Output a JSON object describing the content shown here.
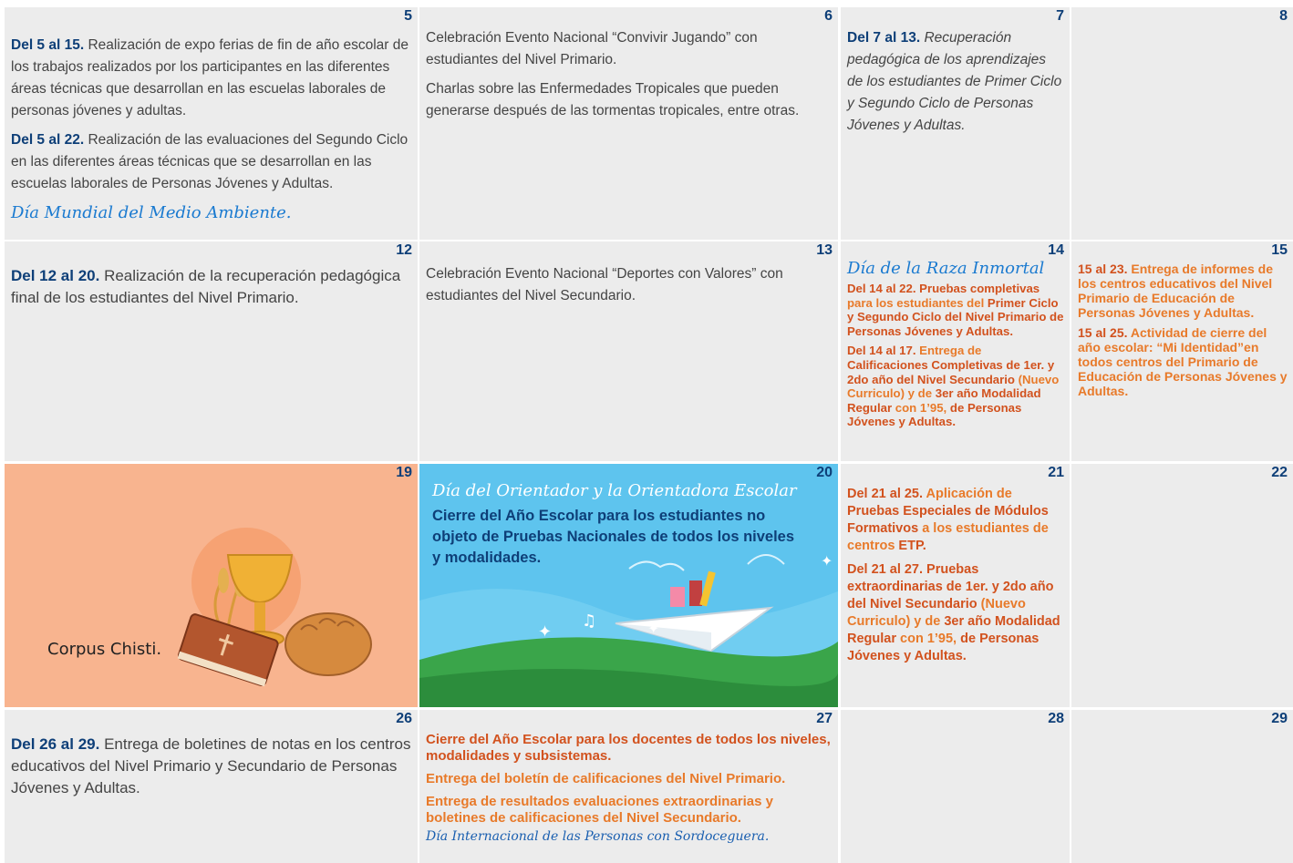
{
  "days": {
    "d5": {
      "num": "5",
      "p1_bold": "Del 5 al 15.",
      "p1_text": " Realización de expo ferias de fin de año escolar de los trabajos realizados por los participantes en las diferentes áreas técnicas que desarrollan en las escuelas laborales de personas jóvenes y adultas.",
      "p2_bold": "Del 5 al 22.",
      "p2_text": " Realización de las evaluaciones del Segundo Ciclo en las diferentes áreas técnicas que se desarrollan en las escuelas laborales de Personas Jóvenes y Adultas.",
      "script": "Día Mundial del Medio Ambiente."
    },
    "d6": {
      "num": "6",
      "p1": "Celebración Evento Nacional “Convivir Jugando” con estudiantes del Nivel Primario.",
      "p2": "Charlas sobre las Enfermedades Tropicales que pueden generarse después de las tormentas tropicales, entre otras."
    },
    "d7": {
      "num": "7",
      "bold": "Del 7 al 13.",
      "text": " Recuperación pedagógica de los aprendizajes de los estudiantes de Primer Ciclo y Segundo Ciclo de Personas Jóvenes y Adultas."
    },
    "d8": {
      "num": "8"
    },
    "d12": {
      "num": "12",
      "bold": "Del 12 al 20.",
      "text": " Realización de la recuperación pedagógica final de los estudiantes del Nivel Primario."
    },
    "d13": {
      "num": "13",
      "text": "Celebración Evento Nacional “Deportes con Valores” con estudiantes del Nivel Secundario."
    },
    "d14": {
      "num": "14",
      "script": "Día de la Raza Inmortal",
      "p1a": "Del 14 al 22. Pruebas completivas",
      "p1b": " para los estudiantes del ",
      "p1c": "Primer Ciclo y Segundo Ciclo del Nivel Primario de Personas Jóvenes y Adultas.",
      "p2a": "Del 14 al 17.",
      "p2b": " Entrega de ",
      "p2c": "Calificaciones Completivas de 1er. y 2do año del Nivel Secundario",
      "p2d": " (Nuevo Curriculo) y de ",
      "p2e": "3er año Modalidad Regular",
      "p2f": " con 1’95, ",
      "p2g": "de Personas Jóvenes y Adultas."
    },
    "d15": {
      "num": "15",
      "p1a": "15  al 23.",
      "p1b": " Entrega de informes de los centros educativos del Nivel Primario de Educación de Personas Jóvenes y Adultas.",
      "p2a": "15 al 25.",
      "p2b": " Actividad de cierre del año escolar: “Mi Identidad”en todos centros del Primario de Educación de Personas Jóvenes y Adultas."
    },
    "d19": {
      "num": "19",
      "label": "Corpus Chisti."
    },
    "d20": {
      "num": "20",
      "script": "Día del Orientador y la Orientadora Escolar",
      "text": "Cierre del Año Escolar para los estudiantes no objeto de Pruebas Nacionales de todos los niveles y modalidades."
    },
    "d21": {
      "num": "21",
      "p1a": "Del 21 al 25.",
      "p1b": " Aplicación de ",
      "p1c": "Pruebas Especiales de Módulos Formativos",
      "p1d": " a los estudiantes de centros ",
      "p1e": "ETP.",
      "p2a": "Del 21 al 27. Pruebas extraordinarias de 1er. y 2do año del Nivel Secundario",
      "p2b": " (Nuevo Curriculo) y de ",
      "p2c": "3er año Modalidad Regular",
      "p2d": " con 1’95, ",
      "p2e": "de Personas Jóvenes y Adultas."
    },
    "d22": {
      "num": "22"
    },
    "d26": {
      "num": "26",
      "bold": "Del 26 al 29.",
      "text": " Entrega de boletines de notas en los centros educativos del Nivel Primario y Secundario de Personas Jóvenes y Adultas."
    },
    "d27": {
      "num": "27",
      "p1": "Cierre del Año Escolar para los docentes de todos los niveles, modalidades y subsistemas.",
      "p2": "Entrega del boletín de calificaciones del Nivel Primario.",
      "p3": "Entrega de resultados evaluaciones extraordinarias y boletines de calificaciones del Nivel Secundario.",
      "script": "Día Internacional de las Personas con Sordoceguera."
    },
    "d28": {
      "num": "28"
    },
    "d29": {
      "num": "29"
    }
  },
  "colors": {
    "cell_bg": "#ececec",
    "day_number": "#0e3f78",
    "accent_blue": "#1a7ad0",
    "orange": "#e87a2a",
    "dark_orange": "#d2521e",
    "corpus_bg": "#f8b48f"
  }
}
